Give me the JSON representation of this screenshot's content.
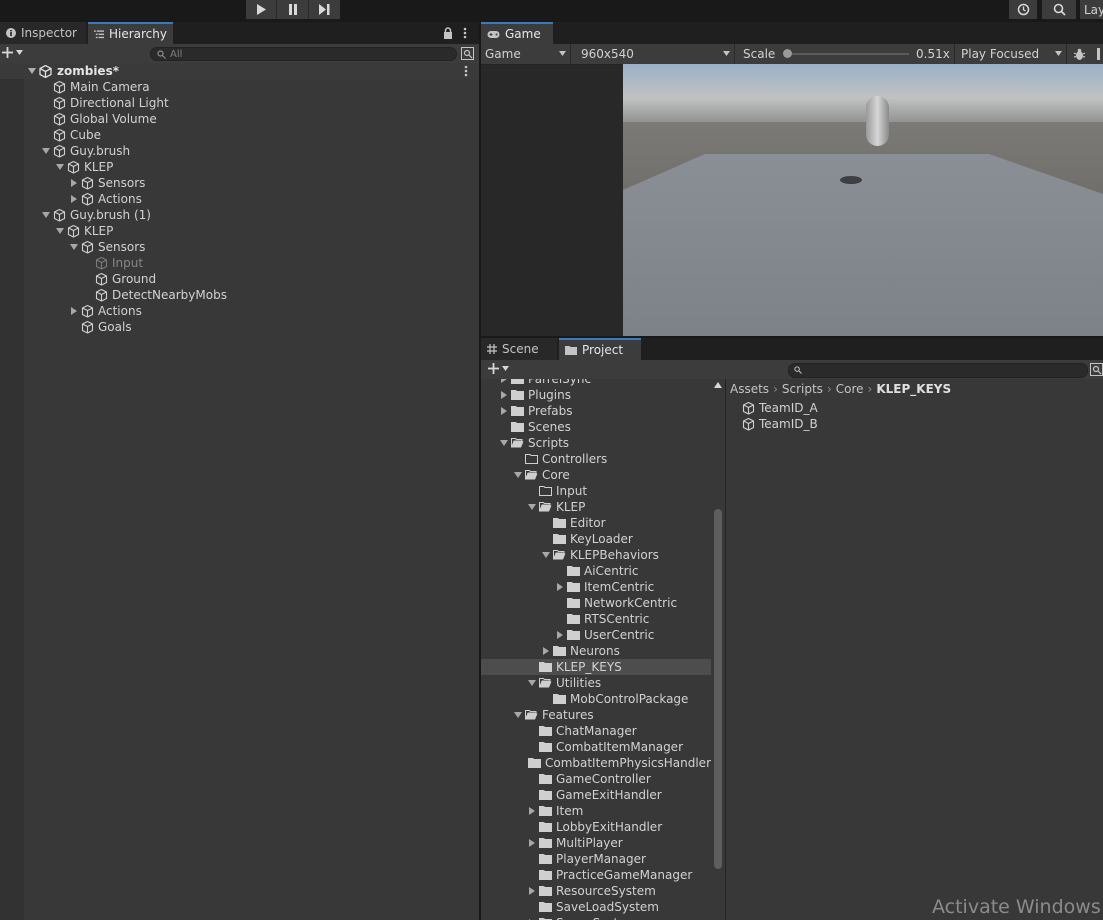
{
  "toolbar": {
    "layers_label": "Lay"
  },
  "hierarchy": {
    "tabs": [
      {
        "label": "Inspector",
        "active": false
      },
      {
        "label": "Hierarchy",
        "active": true
      }
    ],
    "search_placeholder": "All",
    "scene_name": "zombies*",
    "items": [
      {
        "label": "Main Camera",
        "depth": 1,
        "foldout": "none",
        "dim": false
      },
      {
        "label": "Directional Light",
        "depth": 1,
        "foldout": "none",
        "dim": false
      },
      {
        "label": "Global Volume",
        "depth": 1,
        "foldout": "none",
        "dim": false
      },
      {
        "label": "Cube",
        "depth": 1,
        "foldout": "none",
        "dim": false
      },
      {
        "label": "Guy.brush",
        "depth": 1,
        "foldout": "open",
        "dim": false
      },
      {
        "label": "KLEP",
        "depth": 2,
        "foldout": "open",
        "dim": false
      },
      {
        "label": "Sensors",
        "depth": 3,
        "foldout": "closed",
        "dim": false
      },
      {
        "label": "Actions",
        "depth": 3,
        "foldout": "closed",
        "dim": false
      },
      {
        "label": "Guy.brush (1)",
        "depth": 1,
        "foldout": "open",
        "dim": false
      },
      {
        "label": "KLEP",
        "depth": 2,
        "foldout": "open",
        "dim": false
      },
      {
        "label": "Sensors",
        "depth": 3,
        "foldout": "open",
        "dim": false
      },
      {
        "label": "Input",
        "depth": 4,
        "foldout": "none",
        "dim": true
      },
      {
        "label": "Ground",
        "depth": 4,
        "foldout": "none",
        "dim": false
      },
      {
        "label": "DetectNearbyMobs",
        "depth": 4,
        "foldout": "none",
        "dim": false
      },
      {
        "label": "Actions",
        "depth": 3,
        "foldout": "closed",
        "dim": false
      },
      {
        "label": "Goals",
        "depth": 3,
        "foldout": "none",
        "dim": false
      }
    ]
  },
  "game": {
    "tab_label": "Game",
    "display_dropdown": "Game",
    "resolution_dropdown": "960x540",
    "scale_label": "Scale",
    "scale_value": "0.51x",
    "play_mode_dropdown": "Play Focused"
  },
  "project": {
    "tabs": [
      {
        "label": "Scene",
        "active": false
      },
      {
        "label": "Project",
        "active": true
      }
    ],
    "tree": [
      {
        "label": "ParrelSync",
        "depth": 0,
        "foldout": "closed",
        "open": false,
        "selected": false
      },
      {
        "label": "Plugins",
        "depth": 0,
        "foldout": "closed",
        "open": false,
        "selected": false
      },
      {
        "label": "Prefabs",
        "depth": 0,
        "foldout": "closed",
        "open": false,
        "selected": false
      },
      {
        "label": "Scenes",
        "depth": 0,
        "foldout": "none",
        "open": false,
        "selected": false
      },
      {
        "label": "Scripts",
        "depth": 0,
        "foldout": "open",
        "open": true,
        "selected": false
      },
      {
        "label": "Controllers",
        "depth": 1,
        "foldout": "none",
        "open": false,
        "selected": false,
        "empty": true
      },
      {
        "label": "Core",
        "depth": 1,
        "foldout": "open",
        "open": true,
        "selected": false
      },
      {
        "label": "Input",
        "depth": 2,
        "foldout": "none",
        "open": false,
        "selected": false,
        "empty": true
      },
      {
        "label": "KLEP",
        "depth": 2,
        "foldout": "open",
        "open": true,
        "selected": false
      },
      {
        "label": "Editor",
        "depth": 3,
        "foldout": "none",
        "open": false,
        "selected": false
      },
      {
        "label": "KeyLoader",
        "depth": 3,
        "foldout": "none",
        "open": false,
        "selected": false
      },
      {
        "label": "KLEPBehaviors",
        "depth": 3,
        "foldout": "open",
        "open": true,
        "selected": false
      },
      {
        "label": "AiCentric",
        "depth": 4,
        "foldout": "none",
        "open": false,
        "selected": false
      },
      {
        "label": "ItemCentric",
        "depth": 4,
        "foldout": "closed",
        "open": false,
        "selected": false
      },
      {
        "label": "NetworkCentric",
        "depth": 4,
        "foldout": "none",
        "open": false,
        "selected": false
      },
      {
        "label": "RTSCentric",
        "depth": 4,
        "foldout": "none",
        "open": false,
        "selected": false
      },
      {
        "label": "UserCentric",
        "depth": 4,
        "foldout": "closed",
        "open": false,
        "selected": false
      },
      {
        "label": "Neurons",
        "depth": 3,
        "foldout": "closed",
        "open": false,
        "selected": false
      },
      {
        "label": "KLEP_KEYS",
        "depth": 2,
        "foldout": "none",
        "open": false,
        "selected": true
      },
      {
        "label": "Utilities",
        "depth": 2,
        "foldout": "open",
        "open": true,
        "selected": false
      },
      {
        "label": "MobControlPackage",
        "depth": 3,
        "foldout": "none",
        "open": false,
        "selected": false
      },
      {
        "label": "Features",
        "depth": 1,
        "foldout": "open",
        "open": true,
        "selected": false
      },
      {
        "label": "ChatManager",
        "depth": 2,
        "foldout": "none",
        "open": false,
        "selected": false
      },
      {
        "label": "CombatItemManager",
        "depth": 2,
        "foldout": "none",
        "open": false,
        "selected": false
      },
      {
        "label": "CombatItemPhysicsHandler",
        "depth": 2,
        "foldout": "none",
        "open": false,
        "selected": false
      },
      {
        "label": "GameController",
        "depth": 2,
        "foldout": "none",
        "open": false,
        "selected": false
      },
      {
        "label": "GameExitHandler",
        "depth": 2,
        "foldout": "none",
        "open": false,
        "selected": false
      },
      {
        "label": "Item",
        "depth": 2,
        "foldout": "closed",
        "open": false,
        "selected": false
      },
      {
        "label": "LobbyExitHandler",
        "depth": 2,
        "foldout": "none",
        "open": false,
        "selected": false
      },
      {
        "label": "MultiPlayer",
        "depth": 2,
        "foldout": "closed",
        "open": false,
        "selected": false
      },
      {
        "label": "PlayerManager",
        "depth": 2,
        "foldout": "none",
        "open": false,
        "selected": false
      },
      {
        "label": "PracticeGameManager",
        "depth": 2,
        "foldout": "none",
        "open": false,
        "selected": false
      },
      {
        "label": "ResourceSystem",
        "depth": 2,
        "foldout": "closed",
        "open": false,
        "selected": false
      },
      {
        "label": "SaveLoadSystem",
        "depth": 2,
        "foldout": "none",
        "open": false,
        "selected": false
      },
      {
        "label": "SceneSystem",
        "depth": 2,
        "foldout": "closed",
        "open": false,
        "selected": false
      }
    ],
    "breadcrumb": [
      "Assets",
      "Scripts",
      "Core",
      "KLEP_KEYS"
    ],
    "assets": [
      {
        "label": "TeamID_A"
      },
      {
        "label": "TeamID_B"
      }
    ]
  },
  "watermark": "Activate Windows",
  "colors": {
    "accent": "#3a79bb",
    "panel": "#383838",
    "toolbar": "#3c3c3c",
    "text": "#d2d2d2"
  }
}
